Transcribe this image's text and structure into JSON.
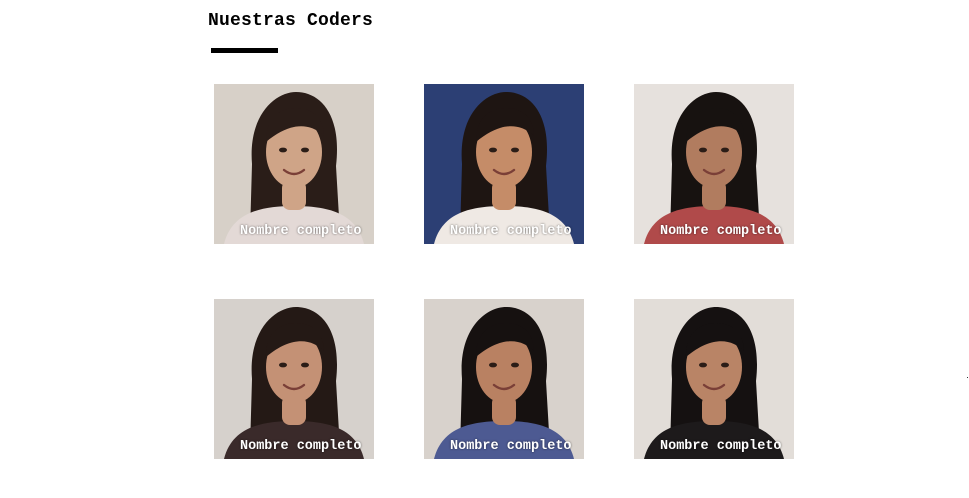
{
  "section": {
    "title": "Nuestras Coders"
  },
  "coders": [
    {
      "name": "Nombre completo",
      "bg": "#d7d0c8",
      "skin": "#cfa487",
      "hair": "#2a1d18",
      "top": "#e3d9d6"
    },
    {
      "name": "Nombre completo",
      "bg": "#2c3f74",
      "skin": "#c58c68",
      "hair": "#1e1512",
      "top": "#efe9e4"
    },
    {
      "name": "Nombre completo",
      "bg": "#e6e1dd",
      "skin": "#b17c5f",
      "hair": "#171210",
      "top": "#b04a4a"
    },
    {
      "name": "Nombre completo",
      "bg": "#d6d1cc",
      "skin": "#c49175",
      "hair": "#241915",
      "top": "#3a2a2a"
    },
    {
      "name": "Nombre completo",
      "bg": "#d8d2cc",
      "skin": "#b98162",
      "hair": "#161110",
      "top": "#4d5a92"
    },
    {
      "name": "Nombre completo",
      "bg": "#e2ddd8",
      "skin": "#b98466",
      "hair": "#151111",
      "top": "#1d1a1b"
    }
  ]
}
